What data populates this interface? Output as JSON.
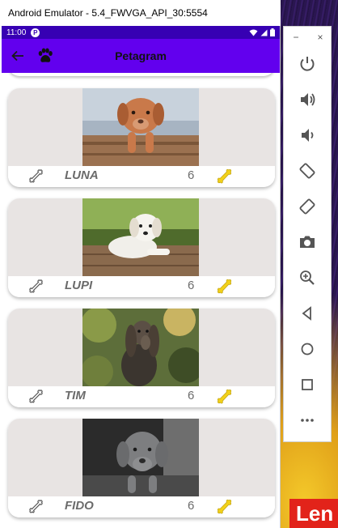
{
  "window": {
    "title": "Android Emulator - 5.4_FWVGA_API_30:5554"
  },
  "status_bar": {
    "time": "11:00",
    "notification_letter": "P"
  },
  "app_bar": {
    "title": "Petagram"
  },
  "pets": [
    {
      "name": "LUNA",
      "likes": "6",
      "photo": "puppy-in-crate"
    },
    {
      "name": "LUPI",
      "likes": "6",
      "photo": "white-puppy-lying"
    },
    {
      "name": "TIM",
      "likes": "6",
      "photo": "saluki"
    },
    {
      "name": "FIDO",
      "likes": "6",
      "photo": "grey-weimaraner"
    }
  ],
  "side_panel": {
    "minimize_label": "−",
    "close_label": "×",
    "buttons": [
      "power-icon",
      "volume-up-icon",
      "volume-down-icon",
      "rotate-left-icon",
      "rotate-right-icon",
      "camera-icon",
      "zoom-icon",
      "back-icon",
      "home-icon",
      "overview-icon",
      "more-icon"
    ]
  },
  "wallpaper": {
    "logo_text": "Len"
  },
  "colors": {
    "status_bar": "#3700b3",
    "app_bar": "#6200ee",
    "bone_yellow": "#f2d11a",
    "text_grey": "#6b6b6b",
    "photo_bg": "#e8e4e3"
  }
}
